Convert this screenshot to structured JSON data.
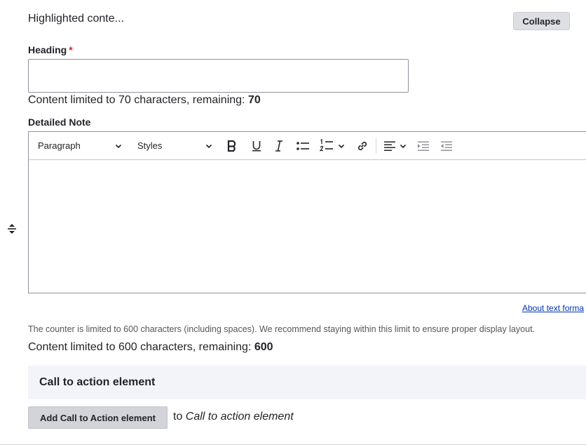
{
  "section": {
    "title": "Highlighted conte...",
    "collapse_label": "Collapse"
  },
  "heading_field": {
    "label": "Heading",
    "required_mark": "*",
    "value": "",
    "counter_prefix": "Content limited to 70 characters, remaining: ",
    "counter_value": "70"
  },
  "detailed_note": {
    "label": "Detailed Note",
    "toolbar": {
      "paragraph_label": "Paragraph",
      "styles_label": "Styles",
      "icons": [
        "chevron-down-icon",
        "bold-icon",
        "underline-icon",
        "italic-icon",
        "bulleted-list-icon",
        "numbered-list-icon",
        "link-icon",
        "align-left-icon",
        "indent-icon",
        "outdent-icon"
      ]
    },
    "about_formats_link": "About text forma",
    "help_text": "The counter is limited to 600 characters (including spaces). We recommend staying within this limit to ensure proper display layout.",
    "counter_prefix": "Content limited to 600 characters, remaining: ",
    "counter_value": "600",
    "resize_icon": "resize-handle-icon"
  },
  "cta": {
    "title": "Call to action element",
    "add_button_label": "Add Call to Action element",
    "to_prefix": "to ",
    "to_target": "Call to action element"
  },
  "colors": {
    "text": "#232429",
    "link": "#0036b1",
    "required": "#dc2323",
    "button_bg": "#dedfe4",
    "cta_bar_bg": "#f3f4f9"
  }
}
